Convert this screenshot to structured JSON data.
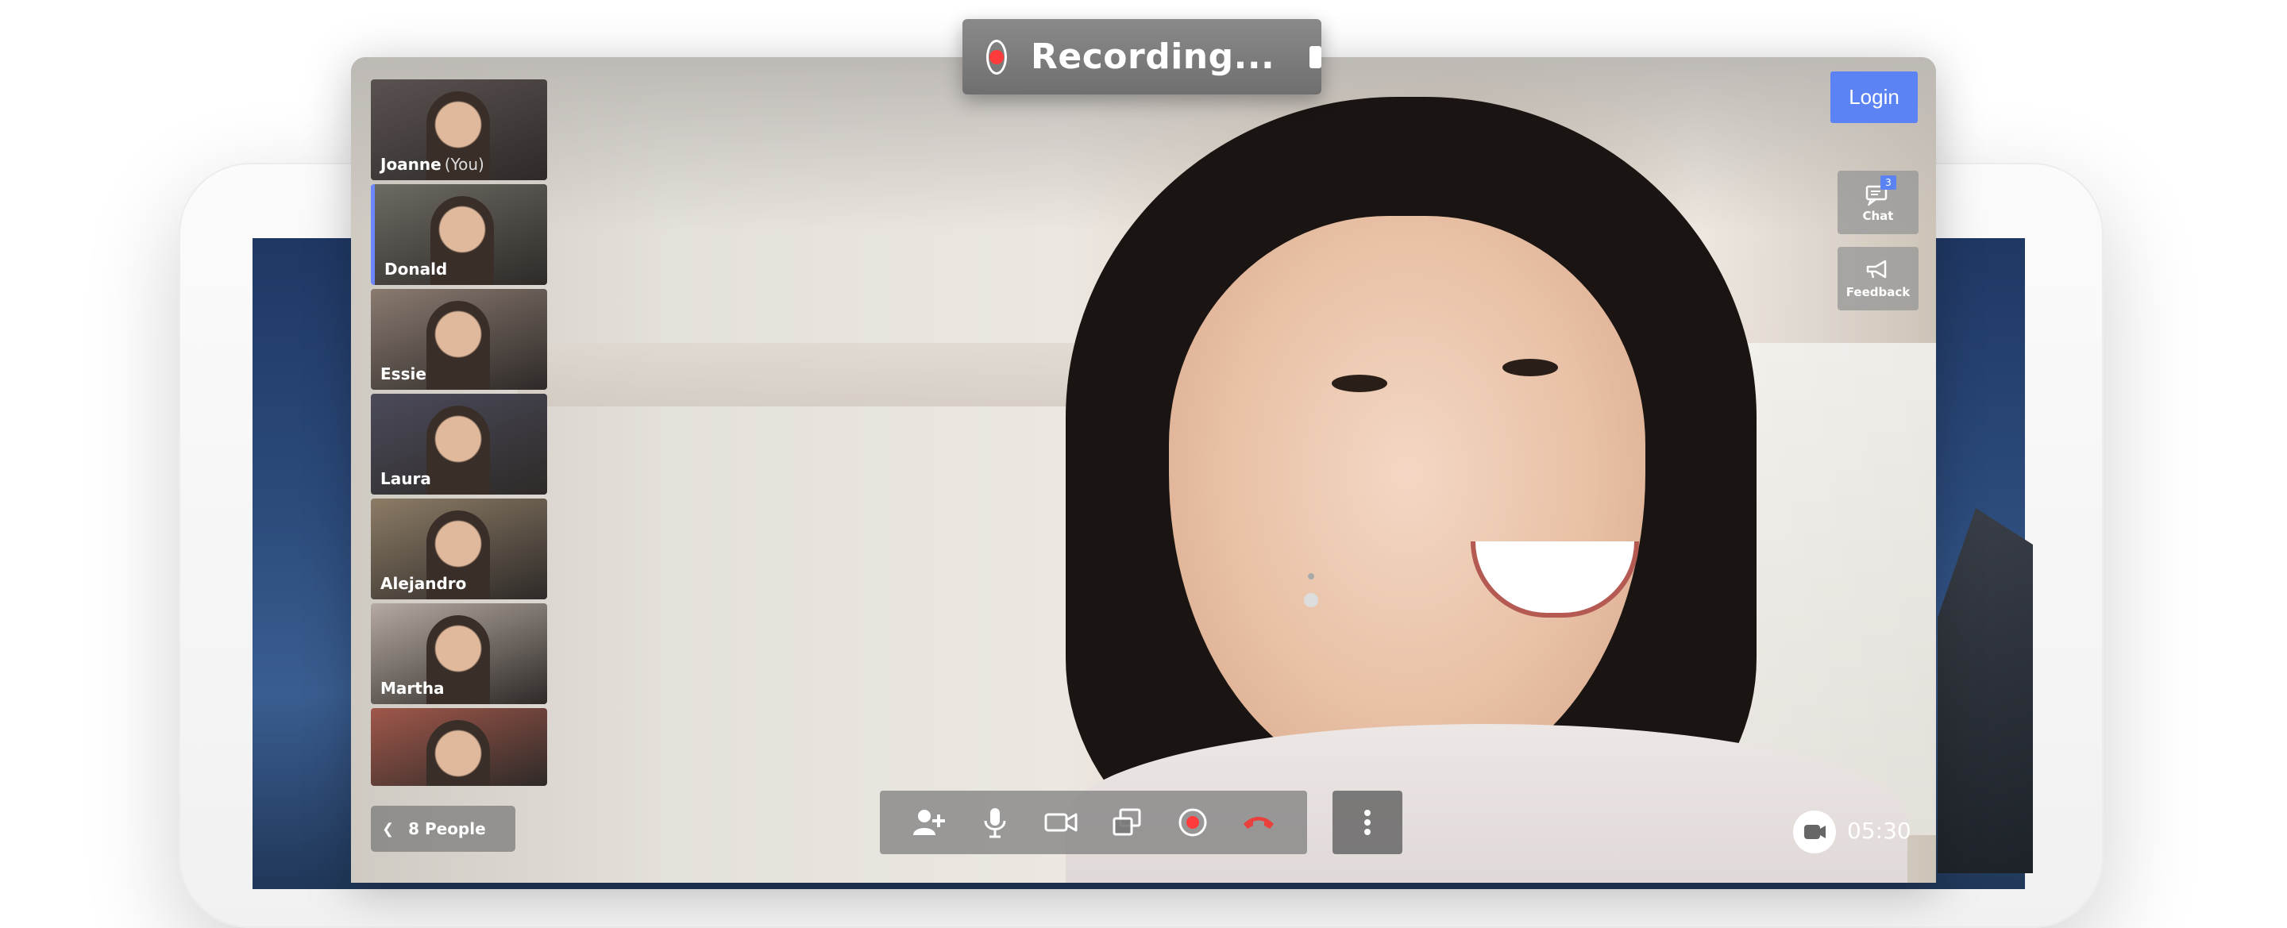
{
  "recording": {
    "status_label": "Recording..."
  },
  "header": {
    "login_label": "Login"
  },
  "side_tools": [
    {
      "label": "Chat",
      "badge": "3",
      "icon": "chat-icon"
    },
    {
      "label": "Feedback",
      "icon": "megaphone-icon"
    }
  ],
  "participants": [
    {
      "name": "Joanne",
      "suffix": "(You)",
      "tone": "#5a5250"
    },
    {
      "name": "Donald",
      "suffix": "",
      "tone": "#6d6a63",
      "active": true
    },
    {
      "name": "Essie",
      "suffix": "",
      "tone": "#8a7a70"
    },
    {
      "name": "Laura",
      "suffix": "",
      "tone": "#4b4a5a"
    },
    {
      "name": "Alejandro",
      "suffix": "",
      "tone": "#8c7c66"
    },
    {
      "name": "Martha",
      "suffix": "",
      "tone": "#b5aaa1"
    },
    {
      "name": "",
      "suffix": "",
      "tone": "#a0574a"
    }
  ],
  "people_toggle": {
    "label": "8 People",
    "icon": "chevron-left-icon"
  },
  "controls": [
    {
      "name": "add-person-button",
      "icon": "add-person-icon"
    },
    {
      "name": "microphone-button",
      "icon": "microphone-icon"
    },
    {
      "name": "camera-button",
      "icon": "video-camera-icon"
    },
    {
      "name": "share-screen-button",
      "icon": "share-screen-icon"
    },
    {
      "name": "record-button",
      "icon": "record-icon"
    },
    {
      "name": "end-call-button",
      "icon": "end-call-icon"
    }
  ],
  "timer": {
    "elapsed": "05:30"
  },
  "colors": {
    "accent": "#5b83f3",
    "record_red": "#ff3b3b",
    "end_call_red": "#e9403c"
  }
}
